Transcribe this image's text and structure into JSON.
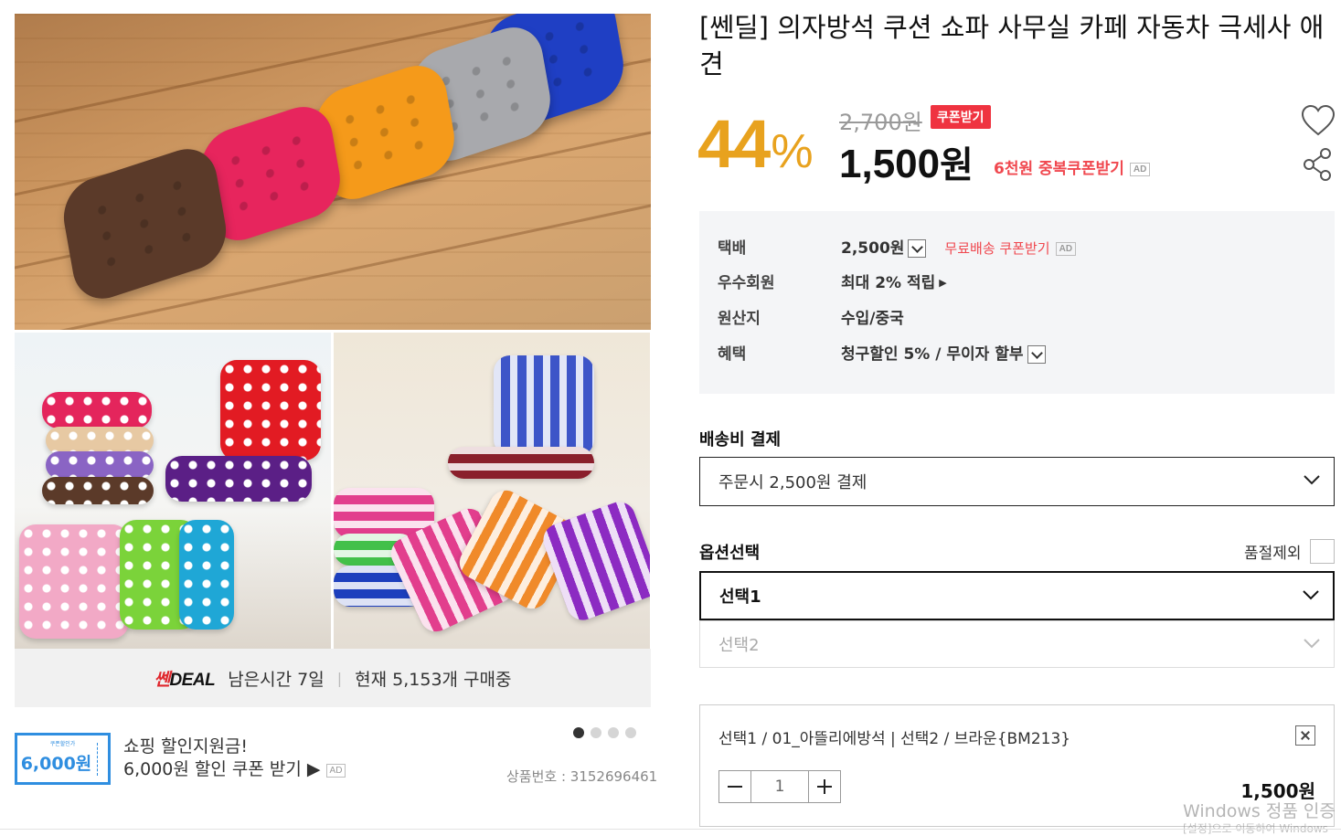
{
  "product": {
    "title": "[쎈딜] 의자방석 쿠션 쇼파 사무실 카페 자동차 극세사 애견",
    "discount_number": "44",
    "discount_unit": "%",
    "original_price": "2,700원",
    "coupon_button": "쿠폰받기",
    "sale_price_number": "1,500",
    "sale_price_unit": "원",
    "dup_coupon": "6천원 중복쿠폰받기",
    "ad_label": "AD",
    "product_no": "상품번호 : 3152696461"
  },
  "deal": {
    "logo_a": "쎈",
    "logo_b": "DEAL",
    "remaining": "남은시간 7일",
    "divider": "|",
    "buying": "현재 5,153개 구매중"
  },
  "promo": {
    "coupon_amount": "6,000원",
    "coupon_tiny": "쿠폰할인가",
    "line1": "쇼핑 할인지원금!",
    "line2": "6,000원 할인 쿠폰 받기 ▶",
    "ad_label": "AD"
  },
  "info": {
    "rows": [
      {
        "key": "택배",
        "value": "2,500원"
      },
      {
        "key": "우수회원",
        "value": "최대 2% 적립"
      },
      {
        "key": "원산지",
        "value": "수입/중국"
      },
      {
        "key": "혜택",
        "value": "청구할인 5% / 무이자 할부"
      }
    ],
    "free_ship": "무료배송 쿠폰받기",
    "ad_label": "AD"
  },
  "shipping": {
    "label": "배송비 결제",
    "selected": "주문시 2,500원 결제"
  },
  "options": {
    "label": "옵션선택",
    "soldout_label": "품절제외",
    "select1": "선택1",
    "select2": "선택2"
  },
  "selection": {
    "text": "선택1 / 01_아뜰리에방석 | 선택2 / 브라운{BM213}",
    "quantity": "1",
    "price": "1,500원"
  },
  "windows": {
    "line1": "Windows 정품 인증",
    "line2": "[설정]으로 이동하여 Windows"
  },
  "carousel": {
    "total": 4,
    "active": 0
  },
  "colors": {
    "discount": "#e8a21e",
    "accent_red": "#ef3340",
    "coupon_blue": "#2f8ee0"
  }
}
